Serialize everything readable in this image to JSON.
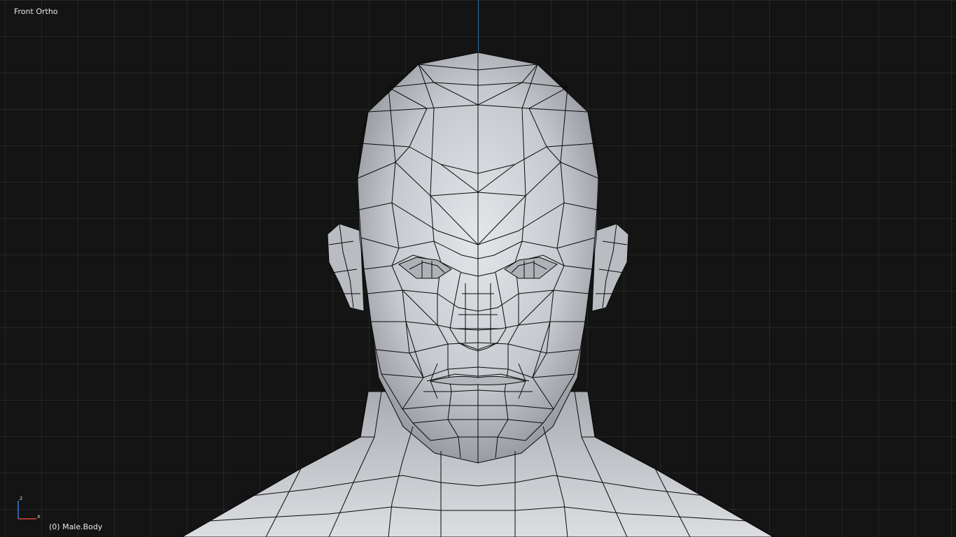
{
  "viewport": {
    "view_name": "Front Ortho",
    "active_object": "(0) Male.Body",
    "axis_gizmo": {
      "up_label": "z",
      "right_label": "x",
      "up_color": "#3d7fd6",
      "right_color": "#d64545"
    },
    "colors": {
      "background": "#141414",
      "grid": "#2a2a2a",
      "y_axis": "#2d6fa8",
      "mesh_fill": "#c9cbcf",
      "wire": "#0a0a0a"
    }
  }
}
